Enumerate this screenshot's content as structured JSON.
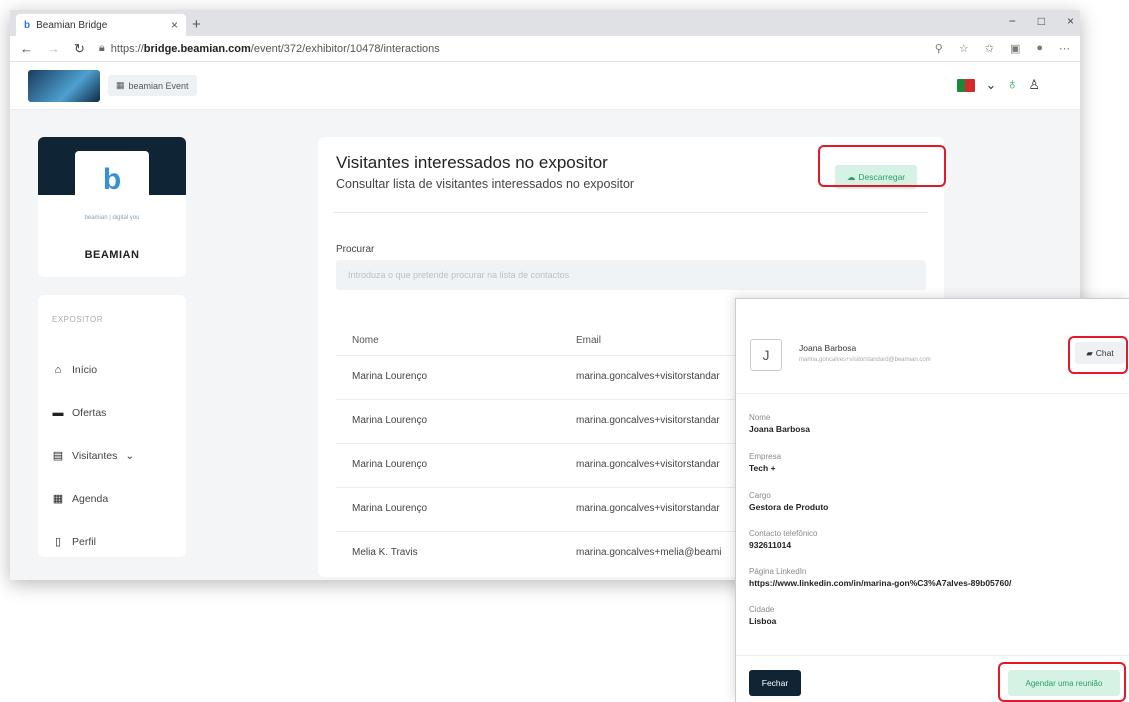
{
  "browser": {
    "tab_title": "Beamian Bridge",
    "tab_close": "×",
    "new_tab": "+",
    "url_prefix": "https://",
    "url_host": "bridge.beamian.com",
    "url_path": "/event/372/exhibitor/10478/interactions",
    "window_controls": [
      "−",
      "□",
      "×"
    ]
  },
  "header": {
    "event_label": "beamian Event"
  },
  "company": {
    "tagline": "beamian | digital you",
    "name": "BEAMIAN"
  },
  "sidebar": {
    "section_title": "EXPOSITOR",
    "items": [
      {
        "label": "Início",
        "icon": "home-icon"
      },
      {
        "label": "Ofertas",
        "icon": "briefcase-icon"
      },
      {
        "label": "Visitantes",
        "icon": "id-card-icon"
      },
      {
        "label": "Agenda",
        "icon": "calendar-icon"
      },
      {
        "label": "Perfil",
        "icon": "clipboard-icon"
      }
    ]
  },
  "main": {
    "title": "Visitantes interessados no expositor",
    "subtitle": "Consultar lista de visitantes interessados no expositor",
    "download_label": "Descarregar",
    "search_label": "Procurar",
    "search_placeholder": "Introduza o que pretende procurar na lista de contactos",
    "columns": [
      "Nome",
      "Email"
    ],
    "rows": [
      {
        "name": "Marina Lourenço",
        "email": "marina.goncalves+visitorstandar"
      },
      {
        "name": "Marina Lourenço",
        "email": "marina.goncalves+visitorstandar"
      },
      {
        "name": "Marina Lourenço",
        "email": "marina.goncalves+visitorstandar"
      },
      {
        "name": "Marina Lourenço",
        "email": "marina.goncalves+visitorstandar"
      },
      {
        "name": "Melia K. Travis",
        "email": "marina.goncalves+melia@beami"
      }
    ]
  },
  "modal": {
    "avatar_initial": "J",
    "name": "Joana Barbosa",
    "email": "marina.goncalves+visitorstandard@beamian.com",
    "chat_label": "Chat",
    "fields": [
      {
        "label": "Nome",
        "value": "Joana Barbosa"
      },
      {
        "label": "Empresa",
        "value": "Tech +"
      },
      {
        "label": "Cargo",
        "value": "Gestora de Produto"
      },
      {
        "label": "Contacto telefônico",
        "value": "932611014"
      },
      {
        "label": "Página LinkedIn",
        "value": "https://www.linkedin.com/in/marina-gon%C3%A7alves-89b05760/"
      },
      {
        "label": "Cidade",
        "value": "Lisboa"
      }
    ],
    "close_label": "Fechar",
    "schedule_label": "Agendar uma reunião"
  },
  "colors": {
    "brand_dark": "#0f2535",
    "accent_green": "#2a9e64",
    "accent_green_bg": "#d6f2e5",
    "highlight_red": "#e11a2b"
  }
}
